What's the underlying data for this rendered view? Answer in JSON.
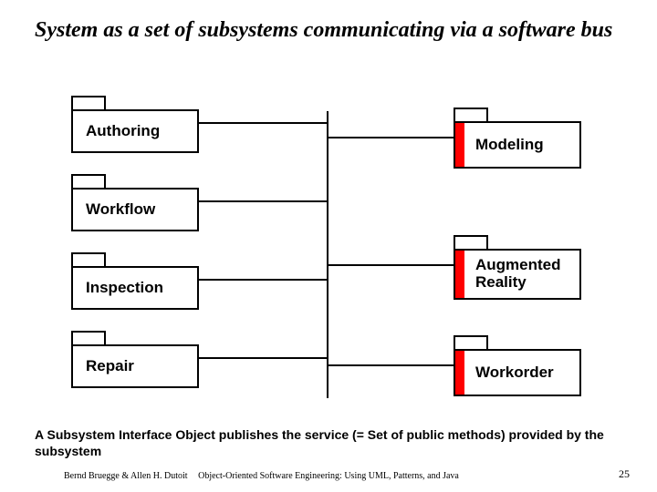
{
  "title": "System as a set of subsystems communicating via a software bus",
  "subsystems": {
    "authoring": "Authoring",
    "workflow": "Workflow",
    "inspection": "Inspection",
    "repair": "Repair",
    "modeling": "Modeling",
    "augmented": "Augmented\nReality",
    "workorder": "Workorder"
  },
  "caption": "A Subsystem Interface Object publishes the service (= Set of public methods) provided by the subsystem",
  "footer": {
    "left": "Bernd Bruegge & Allen H. Dutoit",
    "center": "Object-Oriented Software Engineering: Using UML, Patterns, and Java",
    "page": "25"
  }
}
